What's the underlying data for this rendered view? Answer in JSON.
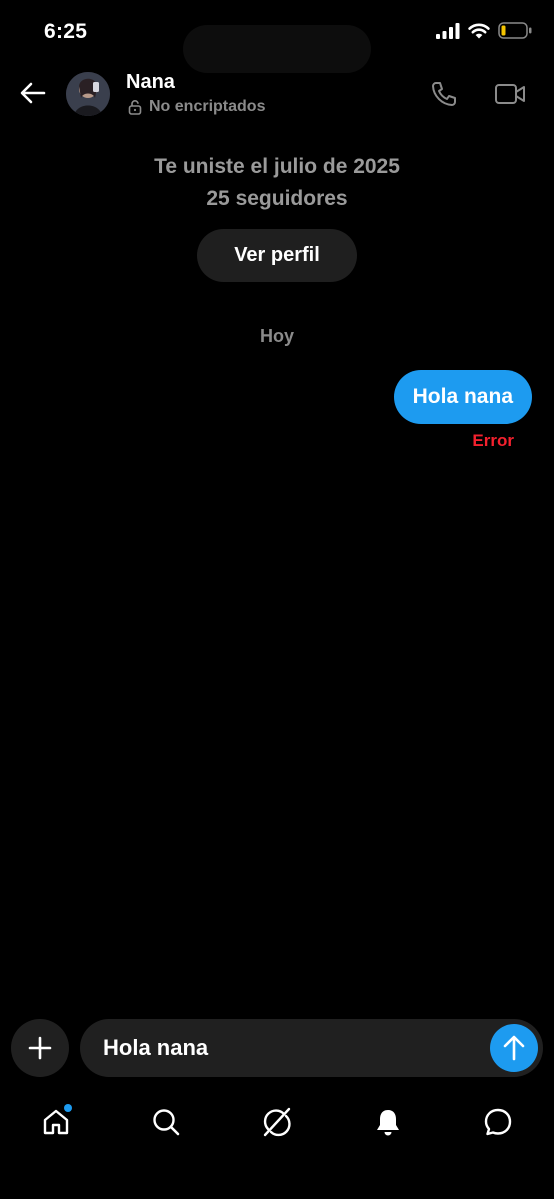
{
  "status_bar": {
    "time": "6:25"
  },
  "header": {
    "contact_name": "Nana",
    "encryption_status": "No encriptados",
    "back_icon": "arrow-left-icon",
    "call_icon": "phone-icon",
    "video_icon": "video-camera-icon"
  },
  "profile": {
    "joined": "Te uniste el julio de 2025",
    "followers": "25 seguidores",
    "view_profile_label": "Ver perfil"
  },
  "conversation": {
    "date_label": "Hoy",
    "messages": [
      {
        "text": "Hola nana",
        "direction": "sent",
        "status": "Error"
      }
    ]
  },
  "composer": {
    "value": "Hola nana",
    "add_icon": "plus-icon",
    "send_icon": "arrow-up-icon"
  },
  "tab_bar": {
    "items": [
      "home-icon",
      "search-icon",
      "grok-icon",
      "bell-icon",
      "message-icon"
    ]
  },
  "colors": {
    "accent": "#1d9bf0",
    "error": "#f4212e",
    "background": "#000000",
    "muted_text": "#9a9a9a",
    "surface": "#202020"
  }
}
